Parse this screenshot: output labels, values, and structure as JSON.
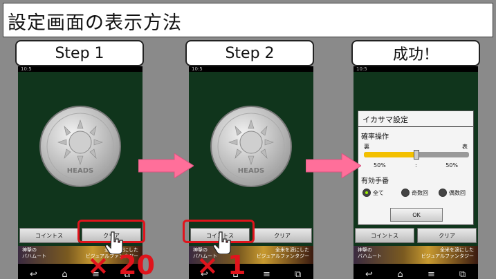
{
  "title": "設定画面の表示方法",
  "steps": [
    {
      "label": "Step 1"
    },
    {
      "label": "Step 2"
    },
    {
      "label": "成功！"
    }
  ],
  "phone": {
    "status": "10:5",
    "toss_button": "コイントス",
    "clear_button": "クリア",
    "ad_left": "神撃の\nバハムート",
    "ad_right": "全米を涙にした\nビジュアルファンタジー",
    "nav_icons": [
      "back-icon",
      "home-icon",
      "menu-icon",
      "recent-apps-icon"
    ]
  },
  "annotations": {
    "step1_count": "× 20",
    "step2_count": "× 1"
  },
  "dialog": {
    "title": "イカサマ設定",
    "probability_label": "確率操作",
    "tails_label": "裏",
    "heads_label": "表",
    "tails_percent": "50%",
    "separator": ":",
    "heads_percent": "50%",
    "slider_value": 0.5,
    "valid_turns_label": "有効手番",
    "option_all": "全て",
    "option_odd": "奇数回",
    "option_even": "偶数回",
    "ok_button": "OK"
  },
  "colors": {
    "highlight": "#e0141c",
    "arrow": "#ff6f9a",
    "slider_fill": "#f3c000",
    "game_bg": "#10351c"
  },
  "coin": {
    "text": "HEADS"
  }
}
